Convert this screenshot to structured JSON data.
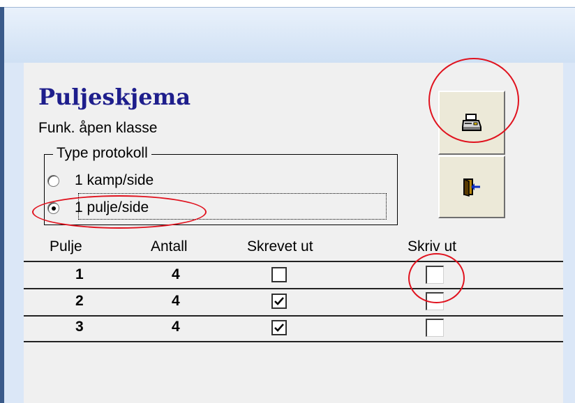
{
  "form": {
    "title": "Puljeskjema",
    "subtitle": "Funk. åpen klasse"
  },
  "protocol_group": {
    "legend": "Type protokoll",
    "options": [
      {
        "label": "1 kamp/side",
        "selected": false
      },
      {
        "label": "1 pulje/side",
        "selected": true
      }
    ]
  },
  "buttons": {
    "print_icon": "printer-icon",
    "exit_icon": "exit-door-icon"
  },
  "table": {
    "headers": [
      "Pulje",
      "Antall",
      "Skrevet ut",
      "Skriv ut"
    ],
    "rows": [
      {
        "pulje": "1",
        "antall": "4",
        "skrevet_ut": false,
        "skriv_ut": false
      },
      {
        "pulje": "2",
        "antall": "4",
        "skrevet_ut": true,
        "skriv_ut": false
      },
      {
        "pulje": "3",
        "antall": "4",
        "skrevet_ut": true,
        "skriv_ut": false
      }
    ]
  },
  "colors": {
    "title": "#1e1e8c",
    "form_background": "#f0f0f0",
    "annotation": "#e0121e"
  }
}
